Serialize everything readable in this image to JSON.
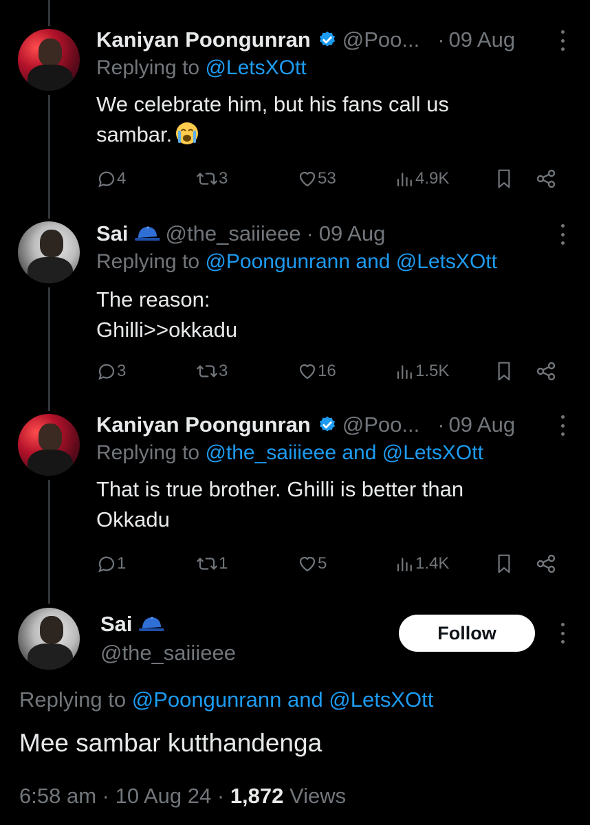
{
  "tweets": [
    {
      "name": "Kaniyan Poongunran",
      "handle": "@Poo...",
      "date": "09 Aug",
      "replying_to_label": "Replying to",
      "replying_to": "@LetsXOtt",
      "text_lines": [
        "We celebrate him, but his fans call us",
        "sambar."
      ],
      "emoji": "loudly-crying-face",
      "replies": "4",
      "retweets": "3",
      "likes": "53",
      "views": "4.9K"
    },
    {
      "name": "Sai",
      "handle": "@the_saiiieee",
      "date": "09 Aug",
      "replying_to_label": "Replying to",
      "replying_to": "@Poongunrann and @LetsXOtt",
      "text_lines": [
        "The reason:",
        "Ghilli>>okkadu"
      ],
      "replies": "3",
      "retweets": "3",
      "likes": "16",
      "views": "1.5K"
    },
    {
      "name": "Kaniyan Poongunran",
      "handle": "@Poo...",
      "date": "09 Aug",
      "replying_to_label": "Replying to",
      "replying_to": "@the_saiiieee and @LetsXOtt",
      "text_lines": [
        "That is true brother. Ghilli is better than",
        "Okkadu"
      ],
      "replies": "1",
      "retweets": "1",
      "likes": "5",
      "views": "1.4K"
    }
  ],
  "main_tweet": {
    "name": "Sai",
    "handle": "@the_saiiieee",
    "follow_label": "Follow",
    "replying_to_label": "Replying to",
    "replying_to": "@Poongunrann and @LetsXOtt",
    "text": "Mee sambar kutthandenga",
    "time": "6:58 am",
    "date": "10 Aug 24",
    "views_count": "1,872",
    "views_label": "Views"
  },
  "separator": "·",
  "colors": {
    "background": "#000000",
    "text": "#e7e9ea",
    "muted": "#71767b",
    "link": "#1d9bf0",
    "verified": "#1d9bf0",
    "button_bg": "#ffffff"
  }
}
